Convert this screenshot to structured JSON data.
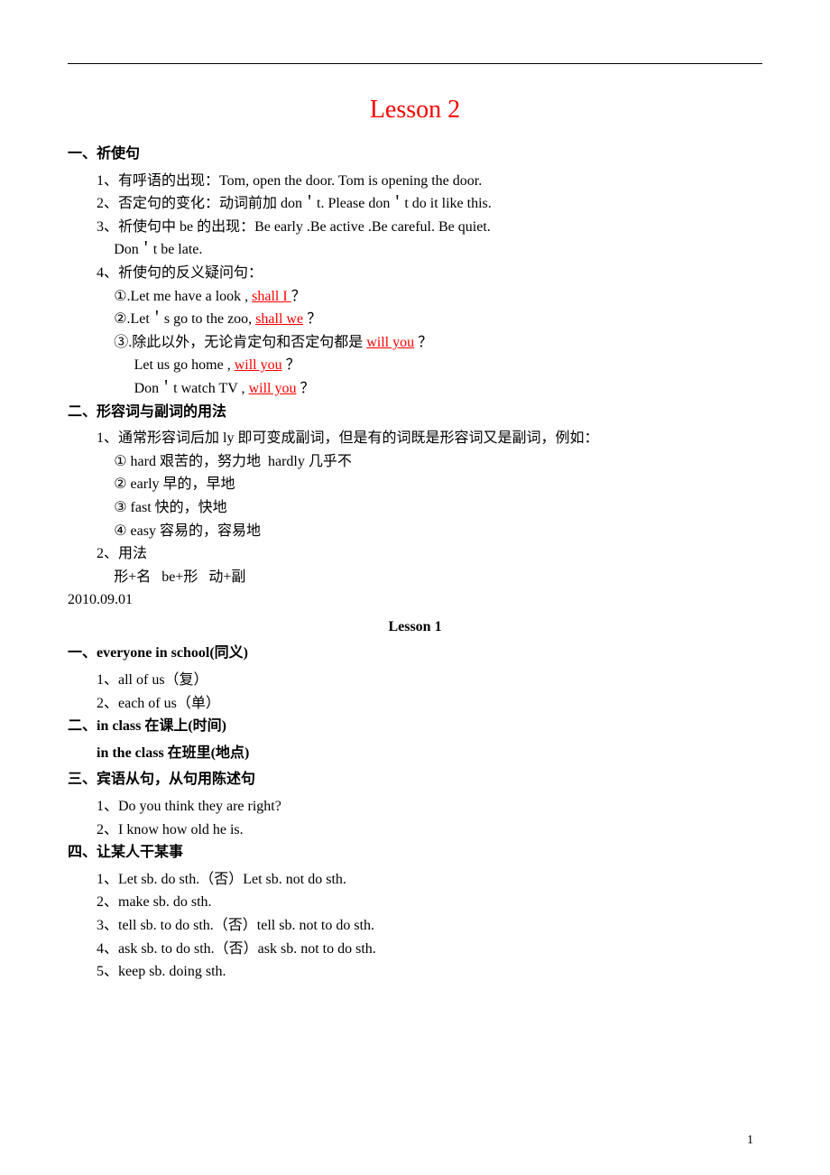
{
  "title": "Lesson 2",
  "s1": {
    "head": "一、祈使句",
    "i1": "1、有呼语的出现：Tom, open the door. Tom is opening the door.",
    "i2": "2、否定句的变化：动词前加 don＇t. Please don＇t do it like this.",
    "i3": "3、祈使句中 be 的出现：Be early .Be active .Be careful. Be quiet.",
    "i3b": "Don＇t be late.",
    "i4": "4、祈使句的反义疑问句：",
    "i4a_pre": "①.Let me have a look , ",
    "i4a_u": "shall I ",
    "i4a_post": "？",
    "i4b_pre": "②.Let＇s go to the zoo, ",
    "i4b_u": "shall we",
    "i4b_post": " ？",
    "i4c_pre": "③.除此以外，无论肯定句和否定句都是 ",
    "i4c_u": "will you",
    "i4c_post": " ？",
    "i4d_pre": "Let us go home , ",
    "i4d_u": "will you",
    "i4d_post": " ？",
    "i4e_pre": "Don＇t watch TV , ",
    "i4e_u": "will you",
    "i4e_post": " ？"
  },
  "s2": {
    "head": "二、形容词与副词的用法",
    "i1": "1、通常形容词后加 ly 即可变成副词，但是有的词既是形容词又是副词，例如：",
    "i1a": "① hard 艰苦的，努力地  hardly 几乎不",
    "i1b": "② early 早的，早地",
    "i1c": "③ fast 快的，快地",
    "i1d": "④ easy 容易的，容易地",
    "i2": "2、用法",
    "i2a": "形+名   be+形   动+副"
  },
  "date": "2010.09.01",
  "sub": "Lesson 1",
  "l1": {
    "head": "一、everyone in school(同义)",
    "a": "1、all of us（复）",
    "b": "2、each of us（单）"
  },
  "l2": {
    "head1": "二、in class 在课上(时间)",
    "head2": "in the class 在班里(地点)"
  },
  "l3": {
    "head": "三、宾语从句，从句用陈述句",
    "a": "1、Do you think they are right?",
    "b": "2、I know how old he is."
  },
  "l4": {
    "head": "四、让某人干某事",
    "a": "1、Let sb. do sth.（否）Let sb. not do sth.",
    "b": "2、make sb. do sth.",
    "c": "3、tell sb. to do sth.（否）tell sb. not to do sth.",
    "d": "4、ask sb. to do sth.（否）ask sb. not to do sth.",
    "e": "5、keep sb. doing sth."
  },
  "page_number": "1"
}
